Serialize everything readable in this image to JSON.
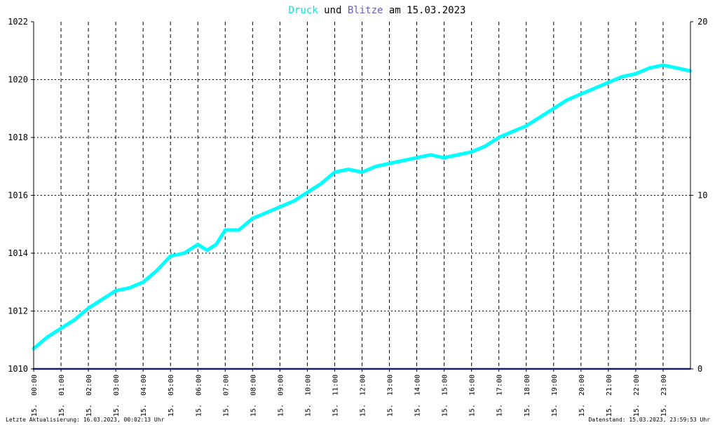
{
  "chart_data": {
    "type": "line",
    "title_parts": [
      {
        "text": "Druck",
        "color": "#00e5e5"
      },
      {
        "text": " und ",
        "color": "#000000"
      },
      {
        "text": "Blitze",
        "color": "#6a5acd"
      },
      {
        "text": " am 15.03.2023",
        "color": "#000000"
      }
    ],
    "left_axis": {
      "ylim": [
        1010,
        1022
      ],
      "ticks": [
        "1010",
        "1012",
        "1014",
        "1016",
        "1018",
        "1020",
        "1022"
      ]
    },
    "right_axis": {
      "ylim": [
        0,
        20
      ],
      "ticks": [
        "0",
        "10",
        "20"
      ]
    },
    "xlim_hours": [
      0,
      24
    ],
    "x_ticks": [
      "15. 00:00",
      "15. 01:00",
      "15. 02:00",
      "15. 03:00",
      "15. 04:00",
      "15. 05:00",
      "15. 06:00",
      "15. 07:00",
      "15. 08:00",
      "15. 09:00",
      "15. 10:00",
      "15. 11:00",
      "15. 12:00",
      "15. 13:00",
      "15. 14:00",
      "15. 15:00",
      "15. 16:00",
      "15. 17:00",
      "15. 18:00",
      "15. 19:00",
      "15. 20:00",
      "15. 21:00",
      "15. 22:00",
      "15. 23:00"
    ],
    "grid": true,
    "series": [
      {
        "name": "Druck",
        "color": "#00ffff",
        "axis": "left",
        "x": [
          "15. 00:00",
          "15. 00:30",
          "15. 01:00",
          "15. 01:30",
          "15. 02:00",
          "15. 02:30",
          "15. 03:00",
          "15. 03:30",
          "15. 04:00",
          "15. 04:30",
          "15. 05:00",
          "15. 05:30",
          "15. 06:00",
          "15. 06:20",
          "15. 06:40",
          "15. 07:00",
          "15. 07:30",
          "15. 08:00",
          "15. 08:30",
          "15. 09:00",
          "15. 09:30",
          "15. 10:00",
          "15. 10:30",
          "15. 11:00",
          "15. 11:30",
          "15. 12:00",
          "15. 12:30",
          "15. 13:00",
          "15. 13:30",
          "15. 14:00",
          "15. 14:30",
          "15. 15:00",
          "15. 15:30",
          "15. 16:00",
          "15. 16:30",
          "15. 17:00",
          "15. 17:30",
          "15. 18:00",
          "15. 18:30",
          "15. 19:00",
          "15. 19:30",
          "15. 20:00",
          "15. 20:30",
          "15. 21:00",
          "15. 21:30",
          "15. 22:00",
          "15. 22:30",
          "15. 23:00",
          "15. 23:30",
          "15. 23:59"
        ],
        "values": [
          1010.7,
          1011.1,
          1011.4,
          1011.7,
          1012.1,
          1012.4,
          1012.7,
          1012.8,
          1013.0,
          1013.4,
          1013.9,
          1014.0,
          1014.3,
          1014.1,
          1014.3,
          1014.8,
          1014.8,
          1015.2,
          1015.4,
          1015.6,
          1015.8,
          1016.1,
          1016.4,
          1016.8,
          1016.9,
          1016.8,
          1017.0,
          1017.1,
          1017.2,
          1017.3,
          1017.4,
          1017.3,
          1017.4,
          1017.5,
          1017.7,
          1018.0,
          1018.2,
          1018.4,
          1018.7,
          1019.0,
          1019.3,
          1019.5,
          1019.7,
          1019.9,
          1020.1,
          1020.2,
          1020.4,
          1020.5,
          1020.4,
          1020.3
        ]
      },
      {
        "name": "Blitze",
        "color": "#1a1a6e",
        "axis": "right",
        "x": [
          "15. 00:00",
          "15. 23:59"
        ],
        "values": [
          0,
          0
        ]
      }
    ]
  },
  "footer": {
    "left": "Letzte Aktualisierung: 16.03.2023, 00:02:13 Uhr",
    "right": "Datenstand: 15.03.2023, 23:59:53 Uhr"
  }
}
